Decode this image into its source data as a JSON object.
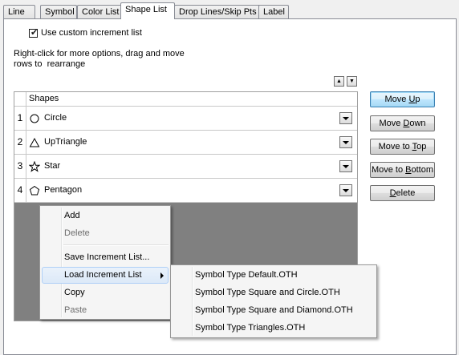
{
  "tabs": [
    "Line",
    "Symbol",
    "Color List",
    "Shape List",
    "Drop Lines/Skip Pts",
    "Label"
  ],
  "active_tab": "Shape List",
  "custom_increment": {
    "label": "Use custom increment list",
    "checked": true
  },
  "hint_line1": "Right-click for more options, drag and move",
  "hint_line2": "rows to  rearrange",
  "grid": {
    "column_header": "Shapes",
    "rows": [
      {
        "num": "1",
        "shape": "Circle",
        "icon": "circle-icon"
      },
      {
        "num": "2",
        "shape": "UpTriangle",
        "icon": "up-triangle-icon"
      },
      {
        "num": "3",
        "shape": "Star",
        "icon": "star-icon"
      },
      {
        "num": "4",
        "shape": "Pentagon",
        "icon": "pentagon-icon"
      }
    ]
  },
  "buttons": {
    "move_up": {
      "pre": "Move ",
      "key": "U",
      "post": "p"
    },
    "move_down": {
      "pre": "Move ",
      "key": "D",
      "post": "own"
    },
    "move_to_top": {
      "pre": "Move to ",
      "key": "T",
      "post": "op"
    },
    "move_to_bottom": {
      "pre": "Move to ",
      "key": "B",
      "post": "ottom"
    },
    "delete": {
      "pre": "",
      "key": "D",
      "post": "elete"
    }
  },
  "context_menu": {
    "add": "Add",
    "delete": "Delete",
    "save_increment_list": "Save Increment List...",
    "load_increment_list": "Load Increment List",
    "copy": "Copy",
    "paste": "Paste"
  },
  "submenu": [
    "Symbol Type Default.OTH",
    "Symbol Type Square and Circle.OTH",
    "Symbol Type Square and Diamond.OTH",
    "Symbol Type Triangles.OTH"
  ]
}
